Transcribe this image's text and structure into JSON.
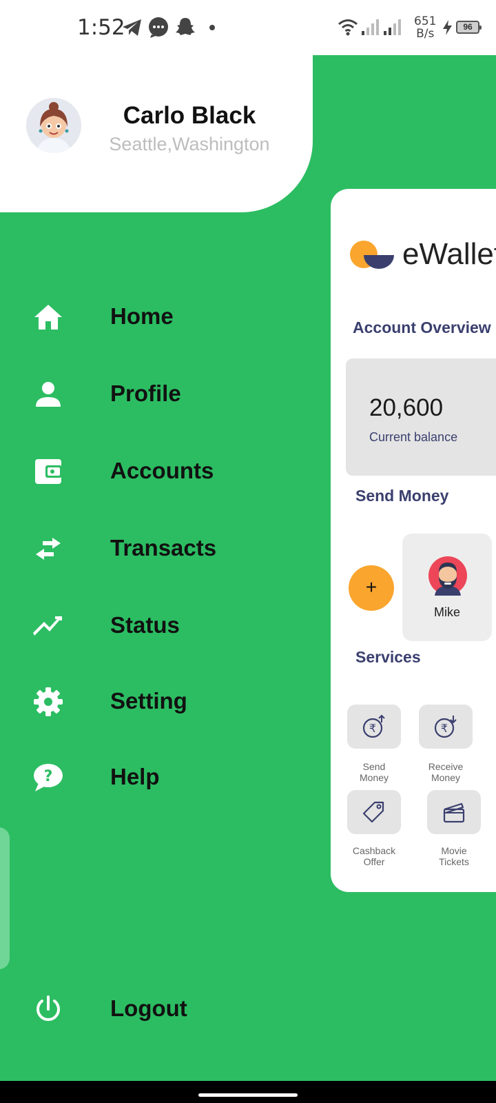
{
  "status_bar": {
    "time": "1:52",
    "speed_value": "651",
    "speed_unit": "B/s",
    "battery": "96",
    "icons": [
      "telegram-icon",
      "chat-icon",
      "snapchat-icon",
      "dot-icon",
      "wifi-icon",
      "signal-icon",
      "signal-icon",
      "charging-icon",
      "battery-icon"
    ]
  },
  "profile": {
    "name": "Carlo Black",
    "location": "Seattle,Washington"
  },
  "menu": {
    "items": [
      {
        "label": "Home",
        "icon": "home-icon"
      },
      {
        "label": "Profile",
        "icon": "person-icon"
      },
      {
        "label": "Accounts",
        "icon": "wallet-icon"
      },
      {
        "label": "Transacts",
        "icon": "swap-arrows-icon"
      },
      {
        "label": "Status",
        "icon": "trending-up-icon"
      },
      {
        "label": "Setting",
        "icon": "gear-icon"
      },
      {
        "label": "Help",
        "icon": "help-chat-icon"
      }
    ],
    "logout": {
      "label": "Logout",
      "icon": "power-icon"
    }
  },
  "app": {
    "logo_text": "eWallet",
    "account_overview": "Account Overview",
    "balance_value": "20,600",
    "balance_label": "Current balance",
    "send_money_title": "Send Money",
    "add_label": "+",
    "contact_name": "Mike",
    "services_title": "Services",
    "services": [
      {
        "line1": "Send",
        "line2": "Money",
        "icon": "rupee-up-icon"
      },
      {
        "line1": "Receive",
        "line2": "Money",
        "icon": "rupee-down-icon"
      },
      {
        "line1": "Cashback",
        "line2": "Offer",
        "icon": "tag-icon"
      },
      {
        "line1": "Movie",
        "line2": "Tickets",
        "icon": "clapperboard-icon"
      }
    ]
  },
  "colors": {
    "drawer_bg": "#2cbd62",
    "accent_orange": "#f9a52e",
    "navy": "#3a3f6e"
  }
}
